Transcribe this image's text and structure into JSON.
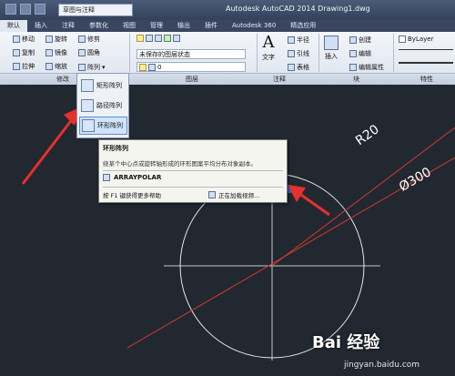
{
  "titlebar": {
    "workspace": "草图与注释",
    "title": "Autodesk AutoCAD 2014   Drawing1.dwg"
  },
  "tabs": [
    "默认",
    "插入",
    "注释",
    "参数化",
    "视图",
    "管理",
    "输出",
    "插件",
    "Autodesk 360",
    "精选应用"
  ],
  "ribbon": {
    "modify": {
      "move": "移动",
      "rotate": "旋转",
      "trim": "修剪",
      "copy": "复制",
      "mirror": "镜像",
      "fillet": "圆角",
      "stretch": "拉伸",
      "scale": "缩放",
      "array": "阵列"
    },
    "layer_state": "未保存的图层状态",
    "layer_value": "0",
    "text": "文字",
    "radius": "半径",
    "leader": "引线",
    "table": "表格",
    "insert": "插入",
    "create": "创建",
    "edit": "编辑",
    "edit_attr": "编辑属性",
    "bylayer": "ByLayer",
    "panels": {
      "modify": "修改",
      "layer": "图层",
      "annotation": "注释",
      "block": "块",
      "properties": "特性"
    }
  },
  "flyout": {
    "rect": "矩形阵列",
    "path": "路径阵列",
    "polar": "环形阵列"
  },
  "tooltip": {
    "title": "环形阵列",
    "desc": "绕某个中心点或旋转轴形成的环形图案平均分布对象副本。",
    "command": "ARRAYPOLAR",
    "help_key": "F1",
    "help": "按 F1 键获得更多帮助",
    "video": "正在加载视频..."
  },
  "drawing": {
    "radius_label": "R20",
    "diameter_label": "Ø300"
  },
  "watermark": {
    "brand": "Bai 经验",
    "url": "jingyan.baidu.com"
  },
  "colors": {
    "canvas": "#212830",
    "annotation_arrow": "#e8302c",
    "grip": "#1e6fe0"
  }
}
